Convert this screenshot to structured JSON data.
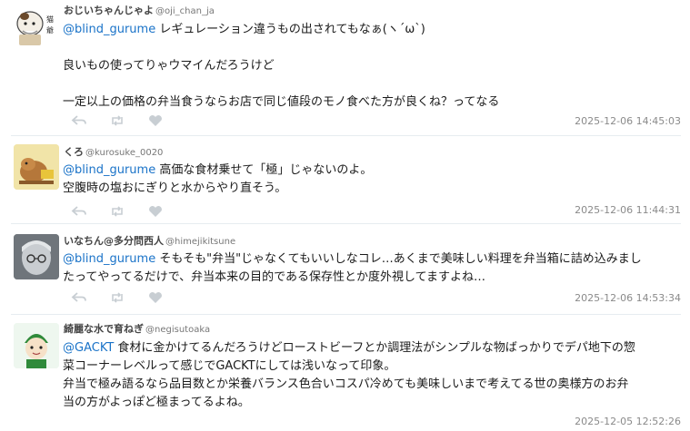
{
  "tweets": [
    {
      "name": "おじいちゃんじゃよ",
      "handle": "@oji_chan_ja",
      "mention": "@blind_gurume",
      "line1_rest": " レギュレーション違うもの出されてもなぁ(ヽ´ω`)",
      "line2": "良いもの使ってりゃウマイんだろうけど",
      "line3": "一定以上の価格の弁当食うならお店で同じ値段のモノ食べた方が良くね？ってなる",
      "time": "2025-12-06 14:45:03"
    },
    {
      "name": "くろ",
      "handle": "@kurosuke_0020",
      "mention": "@blind_gurume",
      "line1_rest": " 高価な食材乗せて「極」じゃないのよ。",
      "line2": "空腹時の塩おにぎりと水からやり直そう。",
      "time": "2025-12-06 11:44:31"
    },
    {
      "name": "いなちん@多分問西人",
      "handle": "@himejikitsune",
      "mention": "@blind_gurume",
      "line1_rest": " そもそも\"弁当\"じゃなくてもいいしなコレ…あくまで美味しい料理を弁当箱に詰め込みまし",
      "line2": "たってやってるだけで、弁当本来の目的である保存性とか度外視してますよね…",
      "time": "2025-12-06 14:53:34"
    },
    {
      "name": "綺麗な水で育ねぎ",
      "handle": "@negisutoaka",
      "mention": "@GACKT",
      "line1_rest": " 食材に金かけてるんだろうけどローストビーフとか調理法がシンプルな物ばっかりでデパ地下の惣",
      "line2": "菜コーナーレベルって感じでGACKTにしては浅いなって印象。",
      "line3": "弁当で極み語るなら品目数とか栄養バランス色合いコスパ冷めても美味しいまで考えてる世の奥様方のお弁",
      "line4": "当の方がよっぽど極まってるよね。",
      "time": "2025-12-05 12:52:26"
    }
  ],
  "icons": {
    "reply": "reply-icon",
    "retweet": "retweet-icon",
    "like": "heart-icon"
  },
  "colors": {
    "mention": "#1a73c8",
    "icon": "#c8ced3",
    "timestamp": "#8a8a8a"
  }
}
